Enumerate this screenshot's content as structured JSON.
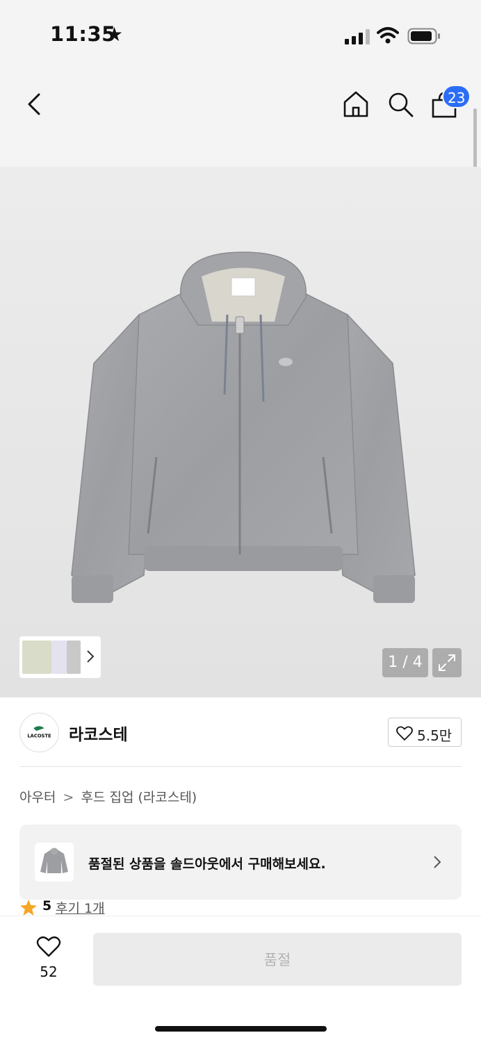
{
  "status_bar": {
    "time": "11:35",
    "star": "★"
  },
  "nav": {
    "cart_count": "23"
  },
  "gallery": {
    "page_indicator": "1 / 4",
    "thumb_colors": [
      "#d9dcc8",
      "#e3e2ee",
      "#c9c9c9"
    ]
  },
  "brand": {
    "logo_text": "LACOSTE",
    "name": "라코스테",
    "likes": "5.5만"
  },
  "breadcrumb": {
    "category": "아우터",
    "separator": ">",
    "subcategory": "후드 집업 (라코스테)"
  },
  "soldout_banner": {
    "text": "품절된 상품을 솔드아웃에서 구매해보세요."
  },
  "rating": {
    "value": "5",
    "reviews": "후기 1개"
  },
  "bottom_bar": {
    "wish_count": "52",
    "buy_button_label": "품절"
  },
  "colors": {
    "accent_badge": "#2b6df5",
    "star": "#f5a623"
  }
}
